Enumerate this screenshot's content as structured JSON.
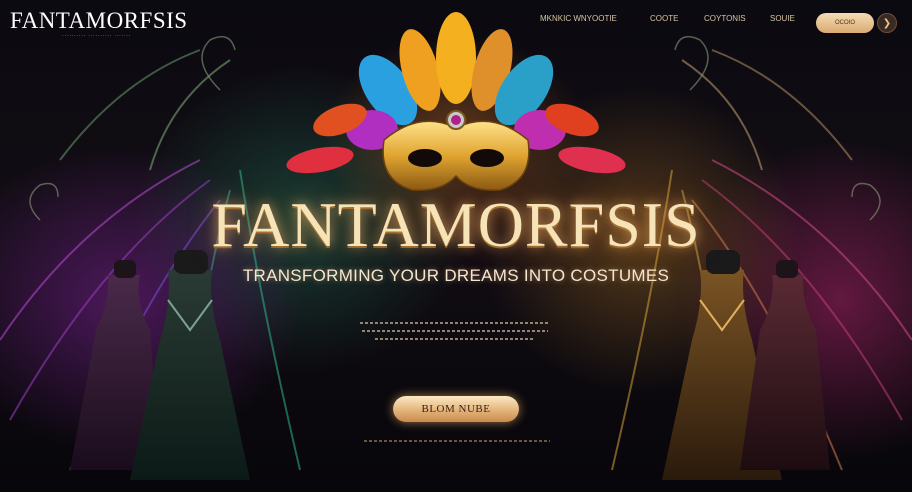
{
  "header": {
    "logo": "FANTAMORFSIS",
    "nav": [
      {
        "label": "MKNKIC WNYOOTIE"
      },
      {
        "label": "COOTE"
      },
      {
        "label": "COYTONIS"
      },
      {
        "label": "SOUIE"
      }
    ],
    "cta_label": "OCOIO",
    "menu_icon": "chevron-right-icon"
  },
  "hero": {
    "title": "FANTAMORFSIS",
    "subtitle": "TRANSFORMING YOUR DREAMS INTO COSTUMES",
    "cta_label": "BLOM NUBE"
  },
  "colors": {
    "accent": "#e3b47a",
    "title_glow": "#ffbe6e",
    "background": "#07060a"
  }
}
